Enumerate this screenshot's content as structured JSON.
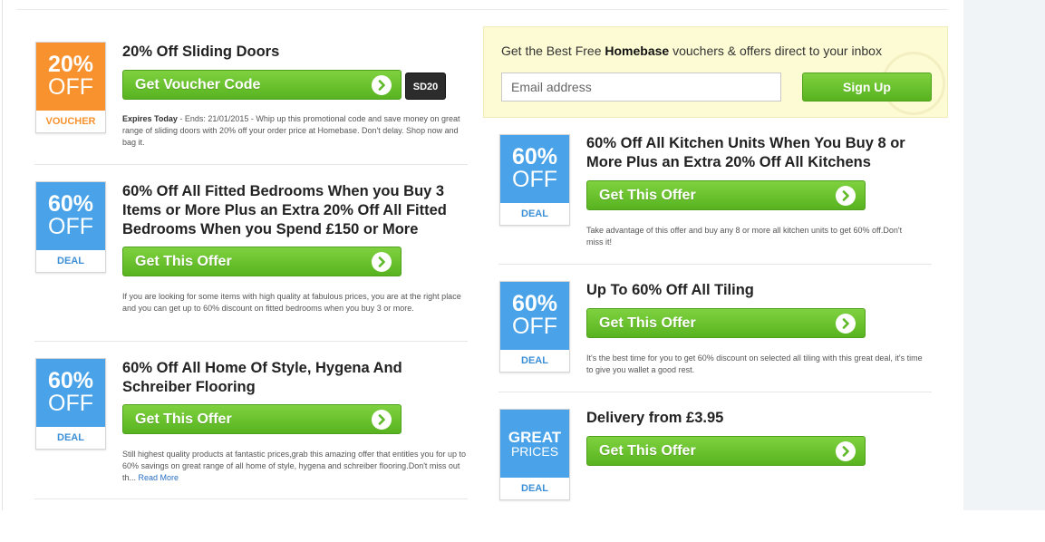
{
  "signup": {
    "text_before": "Get the Best Free ",
    "brand": "Homebase",
    "text_after": " vouchers & offers direct to your inbox",
    "email_placeholder": "Email address",
    "button_label": "Sign Up"
  },
  "offers": [
    {
      "badge_pct": "20%",
      "badge_off": "OFF",
      "badge_type": "VOUCHER",
      "title": "20% Off Sliding Doors",
      "cta": "Get Voucher Code",
      "code": "SD20",
      "expires": "Expires Today",
      "desc": " - Ends: 21/01/2015 - Whip up this promotional code and save money on great range of sliding doors with 20% off your order price at Homebase. Don't delay. Shop now and bag it."
    },
    {
      "badge_pct": "60%",
      "badge_off": "OFF",
      "badge_type": "DEAL",
      "title": "60% Off All Fitted Bedrooms When you Buy 3 Items or More Plus an Extra 20% Off All Fitted Bedrooms When you Spend £150 or More",
      "cta": "Get This Offer",
      "desc": "If you are looking for some items with high quality at fabulous prices, you are at the right place and you can get up to 60% discount on fitted bedrooms when you buy 3 or more."
    },
    {
      "badge_pct": "60%",
      "badge_off": "OFF",
      "badge_type": "DEAL",
      "title": "60% Off All Home Of Style, Hygena And Schreiber Flooring",
      "cta": "Get This Offer",
      "desc": "Still highest quality products at fantastic prices,grab this amazing offer that entitles you for up to 60% savings on great range of all home of style, hygena and schreiber flooring.Don't miss out th... ",
      "read_more": "Read More"
    },
    {
      "badge_pct": "60%",
      "badge_off": "OFF",
      "badge_type": "DEAL",
      "title": "60% Off All Kitchen Units When You Buy 8 or More Plus an Extra 20% Off All Kitchens",
      "cta": "Get This Offer",
      "desc": "Take advantage of this offer and buy any 8 or more all kitchen units to get 60% off.Don't miss it!"
    },
    {
      "badge_pct": "60%",
      "badge_off": "OFF",
      "badge_type": "DEAL",
      "title": "Up To 60% Off All Tiling",
      "cta": "Get This Offer",
      "desc": "It's the best time for you to get 60% discount on selected all tiling with this great deal, it's time to give you wallet a good rest."
    },
    {
      "badge_great": "GREAT",
      "badge_prices": "PRICES",
      "badge_type": "DEAL",
      "title": "Delivery from £3.95",
      "cta": "Get This Offer"
    }
  ],
  "colors": {
    "deal_blue": "#4aa3e8",
    "voucher_orange": "#f7922e",
    "cta_green": "#5db926"
  },
  "icons": {
    "cta_arrow": "chevron-right-circle-icon"
  }
}
